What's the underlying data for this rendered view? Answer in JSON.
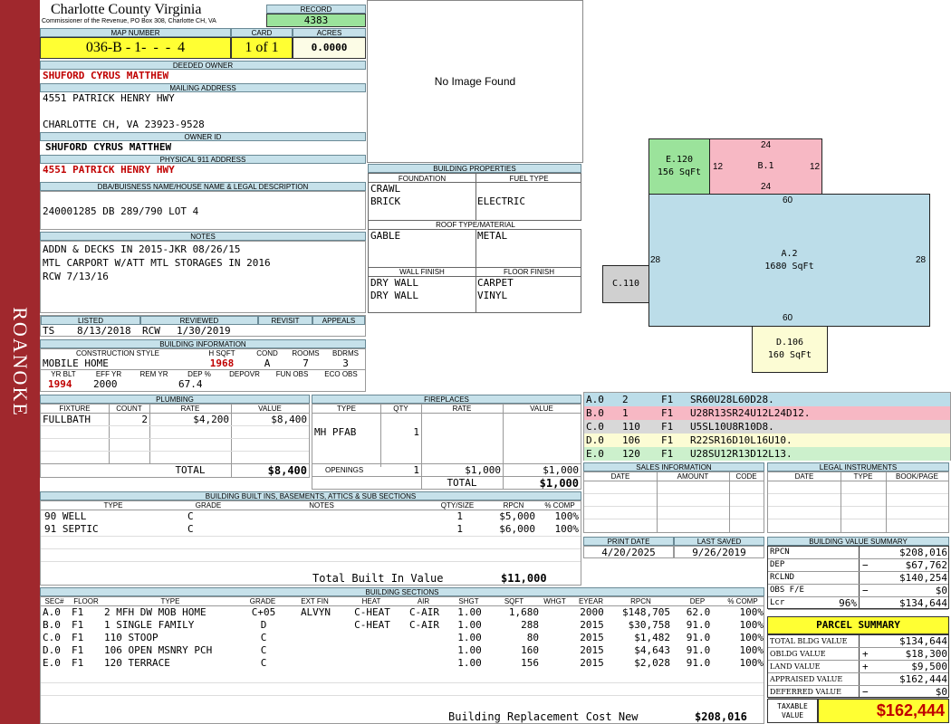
{
  "sidebar": {
    "label": "ROANOKE"
  },
  "header": {
    "county": "Charlotte County Virginia",
    "office": "Commissioner of the Revenue, PO Box 308, Charlotte CH, VA",
    "record_label": "RECORD",
    "record": "4383",
    "map_label": "MAP NUMBER",
    "map_number": "036-B - 1-  -  -  4",
    "card_label": "CARD",
    "card": "1 of 1",
    "acres_label": "ACRES",
    "acres": "0.0000"
  },
  "owner": {
    "deeded_label": "DEEDED OWNER",
    "deeded": "SHUFORD CYRUS MATTHEW",
    "mailing_label": "MAILING ADDRESS",
    "mail1": "4551 PATRICK HENRY HWY",
    "mail2": "",
    "mail3": "CHARLOTTE CH, VA 23923-9528",
    "id_label": "OWNER ID",
    "owner_id": "SHUFORD CYRUS MATTHEW",
    "phys_label": "PHYSICAL 911 ADDRESS",
    "physical": "4551 PATRICK HENRY HWY",
    "dba_label": "DBA/BUISNESS NAME/HOUSE NAME & LEGAL DESCRIPTION",
    "legal": "240001285 DB 289/790 LOT 4"
  },
  "notes": {
    "label": "NOTES",
    "lines": [
      "ADDN & DECKS IN 2015-JKR 08/26/15",
      "MTL CARPORT W/ATT MTL STORAGES IN 2016",
      "RCW 7/13/16"
    ]
  },
  "photo": {
    "text": "No Image Found"
  },
  "listing": {
    "listed_label": "LISTED",
    "listed_by": "TS",
    "listed_date": "8/13/2018",
    "reviewed_label": "REVIEWED",
    "reviewed_by": "RCW",
    "reviewed_date": "1/30/2019",
    "revisit_label": "REVISIT",
    "appeals_label": "APPEALS"
  },
  "building_info": {
    "label": "BUILDING INFORMATION",
    "h_style": "CONSTRUCTION STYLE",
    "h_hsqft": "H SQFT",
    "h_cond": "COND",
    "h_rooms": "ROOMS",
    "h_bdrms": "BDRMS",
    "style": "MOBILE HOME",
    "hsqft": "1968",
    "cond": "A",
    "rooms": "7",
    "bdrms": "3",
    "h_yrblt": "YR BLT",
    "h_effyr": "EFF YR",
    "h_remyr": "REM YR",
    "h_dep": "DEP %",
    "h_depovr": "DEPOVR",
    "h_funobs": "FUN OBS",
    "h_ecoobs": "ECO OBS",
    "yrblt": "1994",
    "effyr": "2000",
    "remyr": "",
    "dep": "67.4",
    "depovr": "",
    "funobs": "",
    "ecoobs": ""
  },
  "props": {
    "label": "BUILDING PROPERTIES",
    "foundation_label": "FOUNDATION",
    "fuel_label": "FUEL TYPE",
    "foundation": [
      "CRAWL",
      "BRICK"
    ],
    "fuel": "ELECTRIC",
    "roof_label": "ROOF TYPE/MATERIAL",
    "roof_type": "GABLE",
    "roof_mat": "METAL",
    "wall_label": "WALL FINISH",
    "floor_label": "FLOOR FINISH",
    "walls": [
      "DRY WALL",
      "DRY WALL"
    ],
    "floors": [
      "CARPET",
      "VINYL"
    ]
  },
  "plumbing": {
    "label": "PLUMBING",
    "h_fixture": "FIXTURE",
    "h_count": "COUNT",
    "h_rate": "RATE",
    "h_value": "VALUE",
    "rows": [
      {
        "fixture": "FULLBATH",
        "count": "2",
        "rate": "$4,200",
        "value": "$8,400"
      }
    ],
    "total_label": "TOTAL",
    "total": "$8,400"
  },
  "fireplaces": {
    "label": "FIREPLACES",
    "h_type": "TYPE",
    "h_qty": "QTY",
    "h_rate": "RATE",
    "h_value": "VALUE",
    "rows": [
      {
        "type": "MH PFAB",
        "qty": "1"
      }
    ],
    "openings_label": "OPENINGS",
    "openings_qty": "1",
    "openings_rate": "$1,000",
    "openings_value": "$1,000",
    "total_label": "TOTAL",
    "total": "$1,000"
  },
  "builtins": {
    "label": "BUILDING BUILT INS, BASEMENTS, ATTICS & SUB SECTIONS",
    "h_type": "TYPE",
    "h_grade": "GRADE",
    "h_notes": "NOTES",
    "h_qty": "QTY/SIZE",
    "h_rpcn": "RPCN",
    "h_comp": "% COMP",
    "rows": [
      {
        "type": "90 WELL",
        "grade": "C",
        "notes": "",
        "qty": "1",
        "rpcn": "$5,000",
        "comp": "100%"
      },
      {
        "type": "91 SEPTIC",
        "grade": "C",
        "notes": "",
        "qty": "1",
        "rpcn": "$6,000",
        "comp": "100%"
      }
    ],
    "total_label": "Total Built In Value",
    "total": "$11,000"
  },
  "sections": {
    "label": "BUILDING SECTIONS",
    "headers": [
      "SEC#",
      "FLOOR",
      "TYPE",
      "GRADE",
      "EXT FIN",
      "HEAT",
      "AIR",
      "SHGT",
      "SQFT",
      "WHGT",
      "EYEAR",
      "RPCN",
      "DEP",
      "% COMP"
    ],
    "rows": [
      {
        "sec": "A.0",
        "floor": "F1",
        "type": "2 MFH DW MOB HOME",
        "grade": "C+05",
        "ext": "ALVYN",
        "heat": "C-HEAT",
        "air": "C-AIR",
        "shgt": "1.00",
        "sqft": "1,680",
        "whgt": "",
        "eyear": "2000",
        "rpcn": "$148,705",
        "dep": "62.0",
        "comp": "100%"
      },
      {
        "sec": "B.0",
        "floor": "F1",
        "type": "1 SINGLE FAMILY",
        "grade": "D",
        "ext": "",
        "heat": "C-HEAT",
        "air": "C-AIR",
        "shgt": "1.00",
        "sqft": "288",
        "whgt": "",
        "eyear": "2015",
        "rpcn": "$30,758",
        "dep": "91.0",
        "comp": "100%"
      },
      {
        "sec": "C.0",
        "floor": "F1",
        "type": "110 STOOP",
        "grade": "C",
        "ext": "",
        "heat": "",
        "air": "",
        "shgt": "1.00",
        "sqft": "80",
        "whgt": "",
        "eyear": "2015",
        "rpcn": "$1,482",
        "dep": "91.0",
        "comp": "100%"
      },
      {
        "sec": "D.0",
        "floor": "F1",
        "type": "106 OPEN MSNRY PCH",
        "grade": "C",
        "ext": "",
        "heat": "",
        "air": "",
        "shgt": "1.00",
        "sqft": "160",
        "whgt": "",
        "eyear": "2015",
        "rpcn": "$4,643",
        "dep": "91.0",
        "comp": "100%"
      },
      {
        "sec": "E.0",
        "floor": "F1",
        "type": "120 TERRACE",
        "grade": "C",
        "ext": "",
        "heat": "",
        "air": "",
        "shgt": "1.00",
        "sqft": "156",
        "whgt": "",
        "eyear": "2015",
        "rpcn": "$2,028",
        "dep": "91.0",
        "comp": "100%"
      }
    ],
    "rcn_label": "Building Replacement Cost New",
    "rcn": "$208,016"
  },
  "sketch": {
    "shapes": [
      {
        "id": "E.120",
        "area": "156 SqFt",
        "color": "#9be39b"
      },
      {
        "id": "B.1",
        "area": "",
        "color": "#f7b8c4"
      },
      {
        "id": "A.2",
        "area": "1680 SqFt",
        "color": "#bcdde9"
      },
      {
        "id": "C.110",
        "area": "",
        "color": "#d0d0d0"
      },
      {
        "id": "D.106",
        "area": "160 SqFt",
        "color": "#fcfcd4"
      }
    ],
    "dims": {
      "b_top": "24",
      "b_bottom": "24",
      "b_left": "12",
      "b_right": "12",
      "a_top": "60",
      "a_bottom": "60",
      "a_left": "28",
      "a_right": "28"
    },
    "legend": [
      {
        "sec": "A.0",
        "n": "2",
        "f": "F1",
        "code": "SR60U28L60D28.",
        "color": "#bcdde9"
      },
      {
        "sec": "B.0",
        "n": "1",
        "f": "F1",
        "code": "U28R13SR24U12L24D12.",
        "color": "#f7b8c4"
      },
      {
        "sec": "C.0",
        "n": "110",
        "f": "F1",
        "code": "U5SL10U8R10D8.",
        "color": "#d8d8d8"
      },
      {
        "sec": "D.0",
        "n": "106",
        "f": "F1",
        "code": "R22SR16D10L16U10.",
        "color": "#fcfcd4"
      },
      {
        "sec": "E.0",
        "n": "120",
        "f": "F1",
        "code": "U28SU12R13D12L13.",
        "color": "#ccf0cc"
      }
    ]
  },
  "sales": {
    "label": "SALES INFORMATION",
    "h_date": "DATE",
    "h_amount": "AMOUNT",
    "h_code": "CODE"
  },
  "legal_inst": {
    "label": "LEGAL INSTRUMENTS",
    "h_date": "DATE",
    "h_type": "TYPE",
    "h_bookpage": "BOOK/PAGE"
  },
  "dates": {
    "print_label": "PRINT DATE",
    "print": "4/20/2025",
    "saved_label": "LAST SAVED",
    "saved": "9/26/2019"
  },
  "value_summary": {
    "label": "BUILDING VALUE SUMMARY",
    "rows": [
      {
        "label": "RPCN",
        "sign": "",
        "pct": "",
        "value": "$208,016"
      },
      {
        "label": "DEP",
        "sign": "−",
        "pct": "",
        "value": "$67,762"
      },
      {
        "label": "RCLND",
        "sign": "",
        "pct": "",
        "value": "$140,254"
      },
      {
        "label": "OBS F/E",
        "sign": "−",
        "pct": "",
        "value": "$0"
      },
      {
        "label": "Lcr",
        "sign": "",
        "pct": "96%",
        "value": "$134,644"
      }
    ]
  },
  "parcel": {
    "label": "PARCEL SUMMARY",
    "rows": [
      {
        "label": "TOTAL BLDG VALUE",
        "sign": "",
        "value": "$134,644"
      },
      {
        "label": "OBLDG VALUE",
        "sign": "+",
        "value": "$18,300"
      },
      {
        "label": "LAND VALUE",
        "sign": "+",
        "value": "$9,500"
      },
      {
        "label": "APPRAISED VALUE",
        "sign": "",
        "value": "$162,444"
      },
      {
        "label": "DEFERRED VALUE",
        "sign": "−",
        "value": "$0"
      }
    ],
    "taxable_label1": "TAXABLE",
    "taxable_label2": "VALUE",
    "taxable": "$162,444"
  }
}
